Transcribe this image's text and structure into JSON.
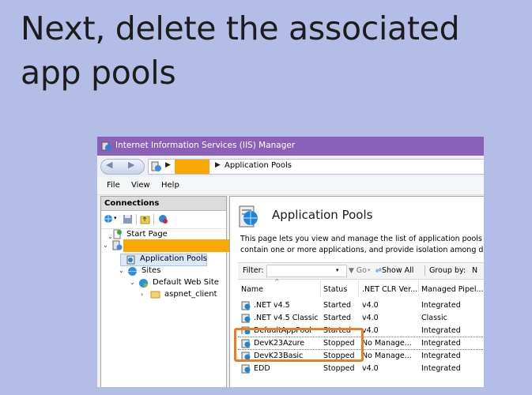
{
  "slide": {
    "title": "Next, delete the associated app pools"
  },
  "window": {
    "title": "Internet Information Services (IIS) Manager"
  },
  "address": {
    "breadcrumb_current": "Application Pools",
    "sep": "▶"
  },
  "nav": {
    "back": "◀",
    "forward": "▶"
  },
  "menu": {
    "file": "File",
    "view": "View",
    "help": "Help"
  },
  "connections": {
    "header": "Connections",
    "tree": {
      "start_page": "Start Page",
      "app_pools": "Application Pools",
      "sites": "Sites",
      "default_web_site": "Default Web Site",
      "aspnet_client": "aspnet_client"
    }
  },
  "main": {
    "title": "Application Pools",
    "desc_line1": "This page lets you view and manage the list of application pools on th",
    "desc_line2": "contain one or more applications, and provide isolation among differ"
  },
  "filter": {
    "label": "Filter:",
    "go": "Go",
    "show_all": "Show All",
    "group_by": "Group by:",
    "group_by_value": "N"
  },
  "grid": {
    "columns": [
      "Name",
      "Status",
      ".NET CLR Ver...",
      "Managed Pipel..."
    ],
    "rows": [
      {
        "name": ".NET v4.5",
        "status": "Started",
        "clr": "v4.0",
        "pipeline": "Integrated"
      },
      {
        "name": ".NET v4.5 Classic",
        "status": "Started",
        "clr": "v4.0",
        "pipeline": "Classic"
      },
      {
        "name": "DefaultAppPool",
        "status": "Started",
        "clr": "v4.0",
        "pipeline": "Integrated"
      },
      {
        "name": "DevK23Azure",
        "status": "Stopped",
        "clr": "No Manage...",
        "pipeline": "Integrated"
      },
      {
        "name": "DevK23Basic",
        "status": "Stopped",
        "clr": "No Manage...",
        "pipeline": "Integrated"
      },
      {
        "name": "EDD",
        "status": "Stopped",
        "clr": "v4.0",
        "pipeline": "Integrated"
      }
    ]
  },
  "colors": {
    "titlebar": "#8b60b8",
    "background": "#b4bde6",
    "highlight": "#ec7d22",
    "redaction": "#f8a800"
  }
}
